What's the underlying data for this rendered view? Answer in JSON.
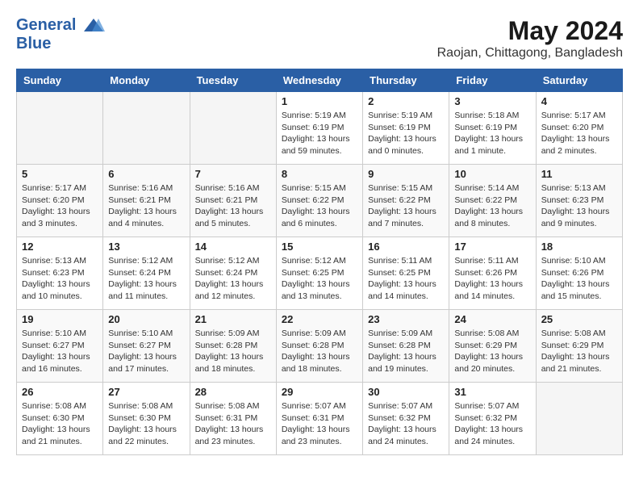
{
  "header": {
    "logo_line1": "General",
    "logo_line2": "Blue",
    "month_year": "May 2024",
    "location": "Raojan, Chittagong, Bangladesh"
  },
  "days_of_week": [
    "Sunday",
    "Monday",
    "Tuesday",
    "Wednesday",
    "Thursday",
    "Friday",
    "Saturday"
  ],
  "weeks": [
    [
      {
        "day": "",
        "empty": true
      },
      {
        "day": "",
        "empty": true
      },
      {
        "day": "",
        "empty": true
      },
      {
        "day": "1",
        "sunrise": "Sunrise: 5:19 AM",
        "sunset": "Sunset: 6:19 PM",
        "daylight": "Daylight: 13 hours and 59 minutes."
      },
      {
        "day": "2",
        "sunrise": "Sunrise: 5:19 AM",
        "sunset": "Sunset: 6:19 PM",
        "daylight": "Daylight: 13 hours and 0 minutes."
      },
      {
        "day": "3",
        "sunrise": "Sunrise: 5:18 AM",
        "sunset": "Sunset: 6:19 PM",
        "daylight": "Daylight: 13 hours and 1 minute."
      },
      {
        "day": "4",
        "sunrise": "Sunrise: 5:17 AM",
        "sunset": "Sunset: 6:20 PM",
        "daylight": "Daylight: 13 hours and 2 minutes."
      }
    ],
    [
      {
        "day": "5",
        "sunrise": "Sunrise: 5:17 AM",
        "sunset": "Sunset: 6:20 PM",
        "daylight": "Daylight: 13 hours and 3 minutes."
      },
      {
        "day": "6",
        "sunrise": "Sunrise: 5:16 AM",
        "sunset": "Sunset: 6:21 PM",
        "daylight": "Daylight: 13 hours and 4 minutes."
      },
      {
        "day": "7",
        "sunrise": "Sunrise: 5:16 AM",
        "sunset": "Sunset: 6:21 PM",
        "daylight": "Daylight: 13 hours and 5 minutes."
      },
      {
        "day": "8",
        "sunrise": "Sunrise: 5:15 AM",
        "sunset": "Sunset: 6:22 PM",
        "daylight": "Daylight: 13 hours and 6 minutes."
      },
      {
        "day": "9",
        "sunrise": "Sunrise: 5:15 AM",
        "sunset": "Sunset: 6:22 PM",
        "daylight": "Daylight: 13 hours and 7 minutes."
      },
      {
        "day": "10",
        "sunrise": "Sunrise: 5:14 AM",
        "sunset": "Sunset: 6:22 PM",
        "daylight": "Daylight: 13 hours and 8 minutes."
      },
      {
        "day": "11",
        "sunrise": "Sunrise: 5:13 AM",
        "sunset": "Sunset: 6:23 PM",
        "daylight": "Daylight: 13 hours and 9 minutes."
      }
    ],
    [
      {
        "day": "12",
        "sunrise": "Sunrise: 5:13 AM",
        "sunset": "Sunset: 6:23 PM",
        "daylight": "Daylight: 13 hours and 10 minutes."
      },
      {
        "day": "13",
        "sunrise": "Sunrise: 5:12 AM",
        "sunset": "Sunset: 6:24 PM",
        "daylight": "Daylight: 13 hours and 11 minutes."
      },
      {
        "day": "14",
        "sunrise": "Sunrise: 5:12 AM",
        "sunset": "Sunset: 6:24 PM",
        "daylight": "Daylight: 13 hours and 12 minutes."
      },
      {
        "day": "15",
        "sunrise": "Sunrise: 5:12 AM",
        "sunset": "Sunset: 6:25 PM",
        "daylight": "Daylight: 13 hours and 13 minutes."
      },
      {
        "day": "16",
        "sunrise": "Sunrise: 5:11 AM",
        "sunset": "Sunset: 6:25 PM",
        "daylight": "Daylight: 13 hours and 14 minutes."
      },
      {
        "day": "17",
        "sunrise": "Sunrise: 5:11 AM",
        "sunset": "Sunset: 6:26 PM",
        "daylight": "Daylight: 13 hours and 14 minutes."
      },
      {
        "day": "18",
        "sunrise": "Sunrise: 5:10 AM",
        "sunset": "Sunset: 6:26 PM",
        "daylight": "Daylight: 13 hours and 15 minutes."
      }
    ],
    [
      {
        "day": "19",
        "sunrise": "Sunrise: 5:10 AM",
        "sunset": "Sunset: 6:27 PM",
        "daylight": "Daylight: 13 hours and 16 minutes."
      },
      {
        "day": "20",
        "sunrise": "Sunrise: 5:10 AM",
        "sunset": "Sunset: 6:27 PM",
        "daylight": "Daylight: 13 hours and 17 minutes."
      },
      {
        "day": "21",
        "sunrise": "Sunrise: 5:09 AM",
        "sunset": "Sunset: 6:28 PM",
        "daylight": "Daylight: 13 hours and 18 minutes."
      },
      {
        "day": "22",
        "sunrise": "Sunrise: 5:09 AM",
        "sunset": "Sunset: 6:28 PM",
        "daylight": "Daylight: 13 hours and 18 minutes."
      },
      {
        "day": "23",
        "sunrise": "Sunrise: 5:09 AM",
        "sunset": "Sunset: 6:28 PM",
        "daylight": "Daylight: 13 hours and 19 minutes."
      },
      {
        "day": "24",
        "sunrise": "Sunrise: 5:08 AM",
        "sunset": "Sunset: 6:29 PM",
        "daylight": "Daylight: 13 hours and 20 minutes."
      },
      {
        "day": "25",
        "sunrise": "Sunrise: 5:08 AM",
        "sunset": "Sunset: 6:29 PM",
        "daylight": "Daylight: 13 hours and 21 minutes."
      }
    ],
    [
      {
        "day": "26",
        "sunrise": "Sunrise: 5:08 AM",
        "sunset": "Sunset: 6:30 PM",
        "daylight": "Daylight: 13 hours and 21 minutes."
      },
      {
        "day": "27",
        "sunrise": "Sunrise: 5:08 AM",
        "sunset": "Sunset: 6:30 PM",
        "daylight": "Daylight: 13 hours and 22 minutes."
      },
      {
        "day": "28",
        "sunrise": "Sunrise: 5:08 AM",
        "sunset": "Sunset: 6:31 PM",
        "daylight": "Daylight: 13 hours and 23 minutes."
      },
      {
        "day": "29",
        "sunrise": "Sunrise: 5:07 AM",
        "sunset": "Sunset: 6:31 PM",
        "daylight": "Daylight: 13 hours and 23 minutes."
      },
      {
        "day": "30",
        "sunrise": "Sunrise: 5:07 AM",
        "sunset": "Sunset: 6:32 PM",
        "daylight": "Daylight: 13 hours and 24 minutes."
      },
      {
        "day": "31",
        "sunrise": "Sunrise: 5:07 AM",
        "sunset": "Sunset: 6:32 PM",
        "daylight": "Daylight: 13 hours and 24 minutes."
      },
      {
        "day": "",
        "empty": true
      }
    ]
  ]
}
